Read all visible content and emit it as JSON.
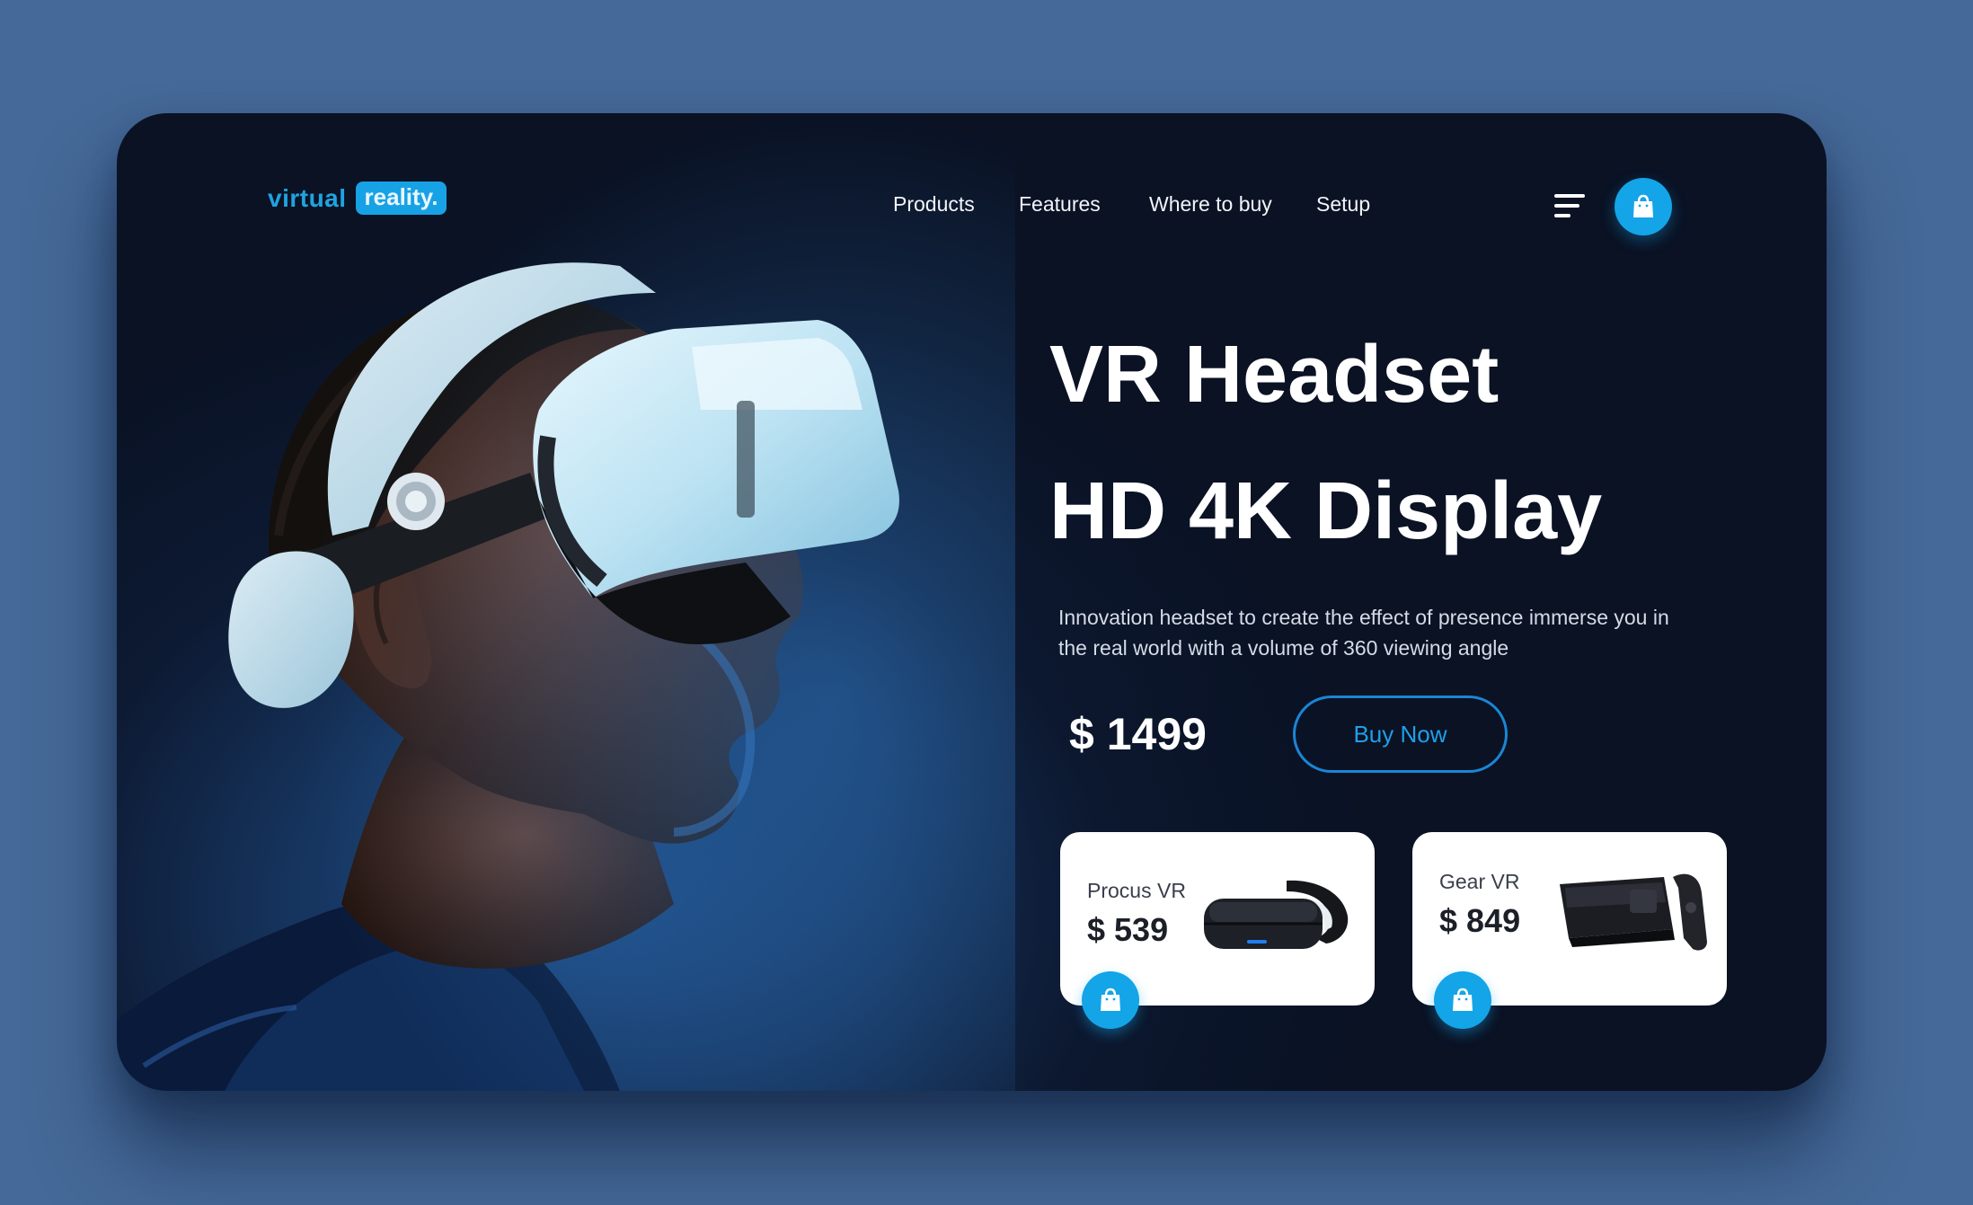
{
  "brand": {
    "word": "virtual",
    "pill": "reality."
  },
  "nav": {
    "items": [
      "Products",
      "Features",
      "Where to buy",
      "Setup"
    ]
  },
  "icons": {
    "menu": "menu-lines-icon",
    "cart": "shopping-bag-icon"
  },
  "hero": {
    "title_line1": "VR Headset",
    "title_line2": "HD 4K Display",
    "description": "Innovation headset to create the effect of presence immerse you in the real world with a volume of 360 viewing angle",
    "price": "$ 1499",
    "cta_label": "Buy Now"
  },
  "products": [
    {
      "name": "Procus VR",
      "price": "$ 539"
    },
    {
      "name": "Gear VR",
      "price": "$ 849"
    }
  ],
  "colors": {
    "page_bg": "#456998",
    "card_bg": "#0d1a33",
    "accent": "#14a4e8",
    "headset": "#bfe4f3"
  }
}
